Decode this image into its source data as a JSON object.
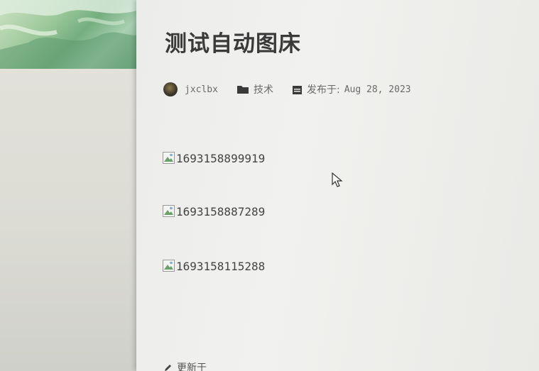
{
  "post": {
    "title": "测试自动图床",
    "author": "jxclbx",
    "category": "技术",
    "published_label": "发布于:",
    "published_date": "Aug 28, 2023"
  },
  "images": [
    {
      "alt": "1693158899919"
    },
    {
      "alt": "1693158887289"
    },
    {
      "alt": "1693158115288"
    }
  ],
  "footer": {
    "edit_label": "更新于"
  },
  "icons": {
    "category": "folder-icon",
    "date": "calendar-icon",
    "edit": "pencil-icon",
    "broken_image": "broken-image-icon"
  }
}
